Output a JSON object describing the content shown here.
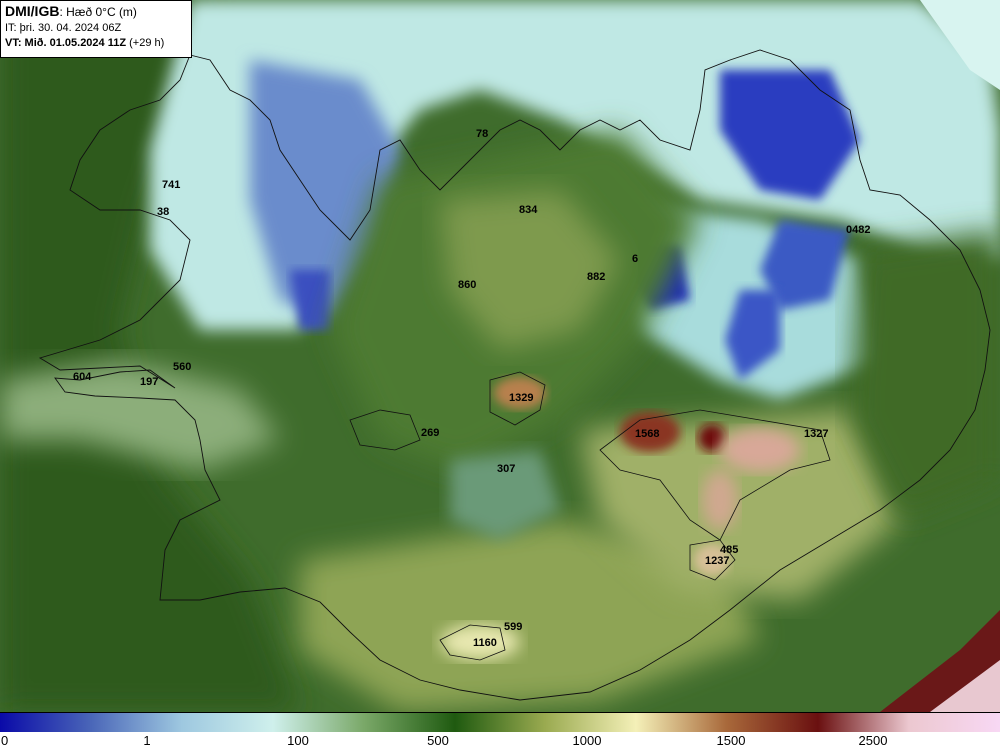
{
  "header": {
    "source": "DMI/IGB",
    "variable": ": Hæð 0°C (m)",
    "initial_time": "IT: þri. 30. 04. 2024 06Z",
    "valid_prefix": "VT: Mið. 01.05.2024 11Z",
    "valid_suffix": " (+29 h)"
  },
  "colorbar": {
    "unit": "m",
    "ticks": [
      "0",
      "1",
      "100",
      "500",
      "1000",
      "1500",
      "2500"
    ],
    "stops": [
      "#0a0aa8",
      "#4a66b8",
      "#9ec8e0",
      "#cff0ec",
      "#7aa868",
      "#1f5a10",
      "#9aaa50",
      "#f4f0b8",
      "#a8683a",
      "#6a1010",
      "#ecc8d0",
      "#f8d8f4"
    ]
  },
  "map_labels": [
    {
      "text": "78"
    },
    {
      "text": "741"
    },
    {
      "text": "38"
    },
    {
      "text": "834"
    },
    {
      "text": "882"
    },
    {
      "text": "860"
    },
    {
      "text": "0482"
    },
    {
      "text": "604"
    },
    {
      "text": "197"
    },
    {
      "text": "560"
    },
    {
      "text": "1329"
    },
    {
      "text": "269"
    },
    {
      "text": "1568"
    },
    {
      "text": "1327"
    },
    {
      "text": "307"
    },
    {
      "text": "485"
    },
    {
      "text": "1237"
    },
    {
      "text": "599"
    },
    {
      "text": "1160"
    },
    {
      "text": "6"
    }
  ]
}
